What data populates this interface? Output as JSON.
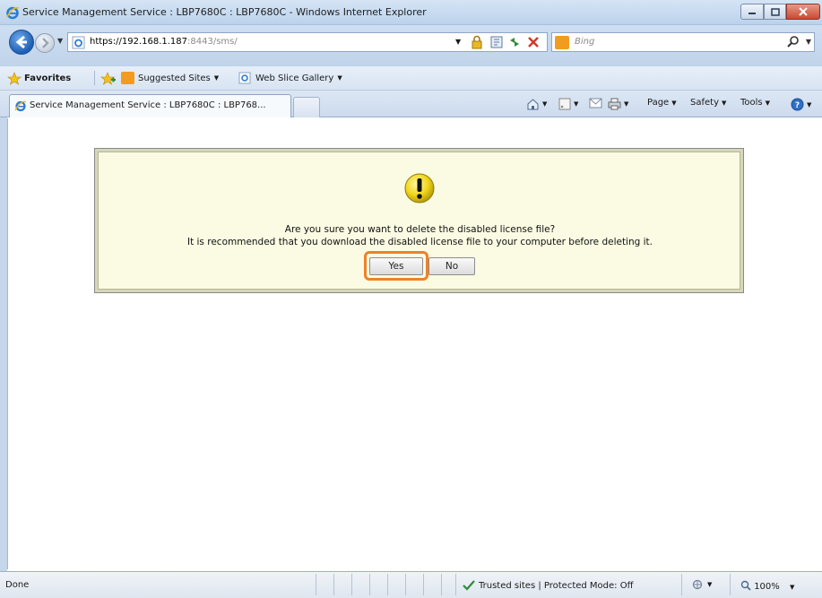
{
  "window": {
    "title": "Service Management Service : LBP7680C : LBP7680C - Windows Internet Explorer"
  },
  "address_bar": {
    "url_host": "https://192.168.1.187",
    "url_rest": ":8443/sms/",
    "search_placeholder": "Bing"
  },
  "favorites_bar": {
    "favorites_label": "Favorites",
    "suggested_sites_label": "Suggested Sites",
    "web_slice_gallery_label": "Web Slice Gallery"
  },
  "tabs": {
    "active_tab_label": "Service Management Service : LBP7680C : LBP768..."
  },
  "command_bar": {
    "page_label": "Page",
    "safety_label": "Safety",
    "tools_label": "Tools"
  },
  "dialog": {
    "message_line1": "Are you sure you want to delete the disabled license file?",
    "message_line2": "It is recommended that you download the disabled license file to your computer before deleting it.",
    "yes_label": "Yes",
    "no_label": "No",
    "highlight_color": "#ee8129"
  },
  "status_bar": {
    "status_text": "Done",
    "zone_text": "Trusted sites | Protected Mode: Off",
    "zoom_text": "100%"
  }
}
